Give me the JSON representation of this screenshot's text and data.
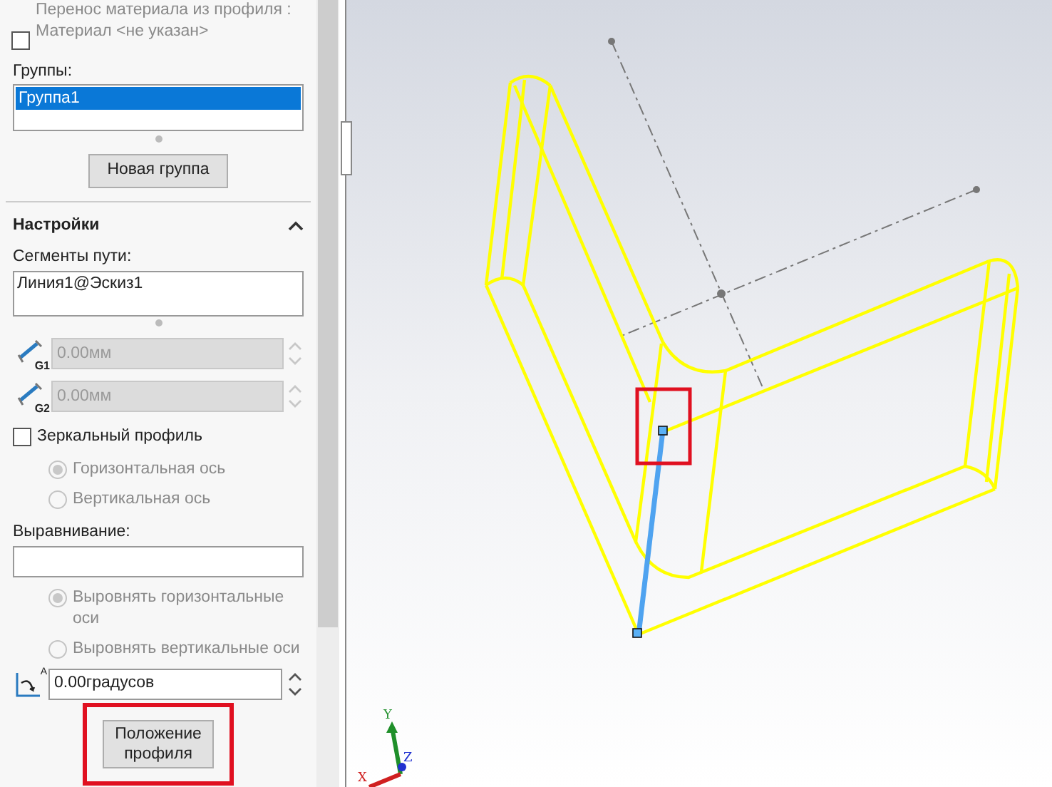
{
  "material_transfer": {
    "checked": false,
    "label": "Перенос материала из профиля : Материал <не указан>"
  },
  "groups": {
    "label": "Группы:",
    "items": [
      {
        "label": "Группа1",
        "selected": true
      }
    ]
  },
  "new_group_button": "Новая группа",
  "settings": {
    "title": "Настройки",
    "expanded": true,
    "path_segments": {
      "label": "Сегменты пути:",
      "items": [
        "Линия1@Эскиз1"
      ]
    },
    "offsets": [
      {
        "icon_label": "G1",
        "value": "0.00мм",
        "disabled": true
      },
      {
        "icon_label": "G2",
        "value": "0.00мм",
        "disabled": true
      }
    ],
    "mirror": {
      "checked": false,
      "label": "Зеркальный профиль",
      "options": [
        {
          "label": "Горизонтальная ось",
          "selected": true,
          "disabled": true
        },
        {
          "label": "Вертикальная ось",
          "selected": false,
          "disabled": true
        }
      ]
    },
    "alignment": {
      "label": "Выравнивание:",
      "options": [
        {
          "label": "Выровнять горизонтальные оси",
          "selected": true,
          "disabled": true
        },
        {
          "label": "Выровнять вертикальные оси",
          "selected": false,
          "disabled": true
        }
      ]
    },
    "angle": {
      "icon_label": "A",
      "value": "0.00градусов"
    },
    "profile_position_button": {
      "label": "Положение профиля",
      "highlighted": true
    }
  },
  "triad": {
    "x": "X",
    "y": "Y",
    "z": "Z"
  }
}
